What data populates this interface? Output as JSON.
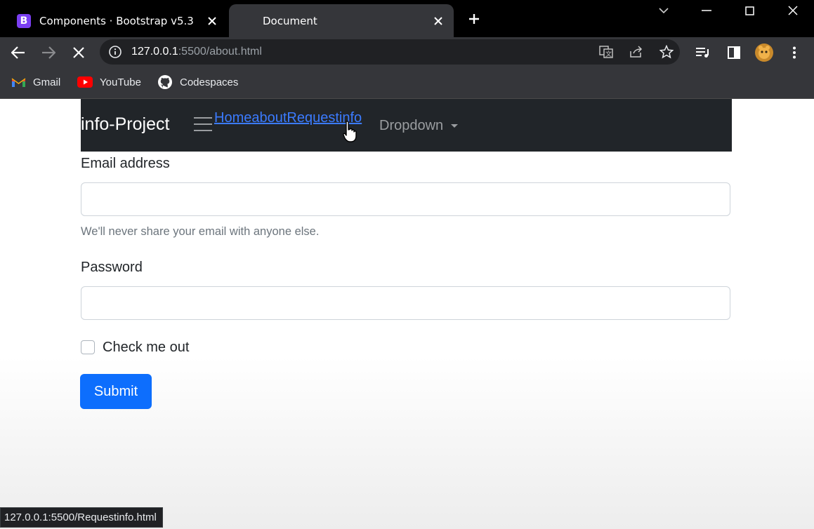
{
  "browser": {
    "tabs": [
      {
        "title": "Components · Bootstrap v5.3",
        "favicon": "B",
        "favicon_color": "#7b3ff2",
        "active": false
      },
      {
        "title": "Document",
        "active": true
      }
    ],
    "url": {
      "host": "127.0.0.1",
      "path": ":5500/about.html"
    },
    "bookmarks": [
      {
        "label": "Gmail",
        "icon": "gmail-icon"
      },
      {
        "label": "YouTube",
        "icon": "youtube-icon"
      },
      {
        "label": "Codespaces",
        "icon": "github-icon"
      }
    ],
    "status_url": "127.0.0.1:5500/Requestinfo.html"
  },
  "navbar": {
    "brand": "info-Project",
    "links": [
      "Home",
      "about",
      "Requestinfo"
    ],
    "dropdown": "Dropdown",
    "bg_color": "#212529"
  },
  "form": {
    "email_label": "Email address",
    "email_help": "We'll never share your email with anyone else.",
    "password_label": "Password",
    "check_label": "Check me out",
    "submit_label": "Submit",
    "submit_color": "#0d6efd"
  }
}
